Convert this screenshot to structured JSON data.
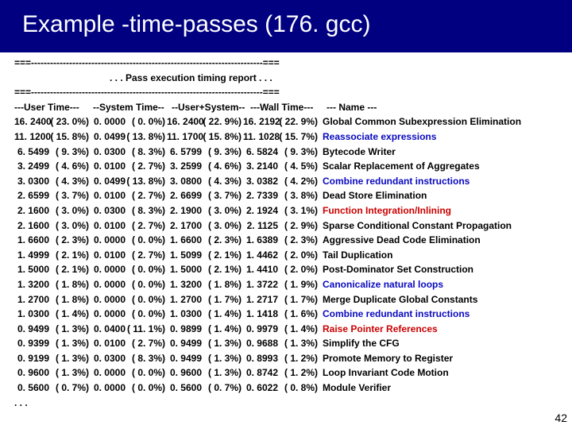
{
  "title": "Example -time-passes (176. gcc)",
  "rule": "===-------------------------------------------------------------------------===",
  "report_title": ". . . Pass execution timing report . . .",
  "headers": {
    "user": "---User Time---",
    "system": "--System Time--",
    "both": "--User+System--",
    "wall": "---Wall Time---",
    "name": "--- Name ---"
  },
  "rows": [
    {
      "u": "16. 2400",
      "up": "23. 0%",
      "s": "0. 0000",
      "sp": "0. 0%",
      "b": "16. 2400",
      "bp": "22. 9%",
      "w": "16. 2192",
      "wp": "22. 9%",
      "n": "Global Common Subexpression Elimination",
      "c": ""
    },
    {
      "u": "11. 1200",
      "up": "15. 8%",
      "s": "0. 0499",
      "sp": "13. 8%",
      "b": "11. 1700",
      "bp": "15. 8%",
      "w": "11. 1028",
      "wp": "15. 7%",
      "n": "Reassociate expressions",
      "c": "blue"
    },
    {
      "u": "6. 5499",
      "up": "9. 3%",
      "s": "0. 0300",
      "sp": "8. 3%",
      "b": "6. 5799",
      "bp": "9. 3%",
      "w": "6. 5824",
      "wp": "9. 3%",
      "n": "Bytecode Writer",
      "c": ""
    },
    {
      "u": "3. 2499",
      "up": "4. 6%",
      "s": "0. 0100",
      "sp": "2. 7%",
      "b": "3. 2599",
      "bp": "4. 6%",
      "w": "3. 2140",
      "wp": "4. 5%",
      "n": "Scalar Replacement of Aggregates",
      "c": ""
    },
    {
      "u": "3. 0300",
      "up": "4. 3%",
      "s": "0. 0499",
      "sp": "13. 8%",
      "b": "3. 0800",
      "bp": "4. 3%",
      "w": "3. 0382",
      "wp": "4. 2%",
      "n": "Combine redundant instructions",
      "c": "blue"
    },
    {
      "u": "2. 6599",
      "up": "3. 7%",
      "s": "0. 0100",
      "sp": "2. 7%",
      "b": "2. 6699",
      "bp": "3. 7%",
      "w": "2. 7339",
      "wp": "3. 8%",
      "n": "Dead Store Elimination",
      "c": ""
    },
    {
      "u": "2. 1600",
      "up": "3. 0%",
      "s": "0. 0300",
      "sp": "8. 3%",
      "b": "2. 1900",
      "bp": "3. 0%",
      "w": "2. 1924",
      "wp": "3. 1%",
      "n": "Function Integration/Inlining",
      "c": "red"
    },
    {
      "u": "2. 1600",
      "up": "3. 0%",
      "s": "0. 0100",
      "sp": "2. 7%",
      "b": "2. 1700",
      "bp": "3. 0%",
      "w": "2. 1125",
      "wp": "2. 9%",
      "n": "Sparse Conditional Constant Propagation",
      "c": ""
    },
    {
      "u": "1. 6600",
      "up": "2. 3%",
      "s": "0. 0000",
      "sp": "0. 0%",
      "b": "1. 6600",
      "bp": "2. 3%",
      "w": "1. 6389",
      "wp": "2. 3%",
      "n": "Aggressive Dead Code Elimination",
      "c": ""
    },
    {
      "u": "1. 4999",
      "up": "2. 1%",
      "s": "0. 0100",
      "sp": "2. 7%",
      "b": "1. 5099",
      "bp": "2. 1%",
      "w": "1. 4462",
      "wp": "2. 0%",
      "n": "Tail Duplication",
      "c": ""
    },
    {
      "u": "1. 5000",
      "up": "2. 1%",
      "s": "0. 0000",
      "sp": "0. 0%",
      "b": "1. 5000",
      "bp": "2. 1%",
      "w": "1. 4410",
      "wp": "2. 0%",
      "n": "Post-Dominator Set Construction",
      "c": ""
    },
    {
      "u": "1. 3200",
      "up": "1. 8%",
      "s": "0. 0000",
      "sp": "0. 0%",
      "b": "1. 3200",
      "bp": "1. 8%",
      "w": "1. 3722",
      "wp": "1. 9%",
      "n": "Canonicalize natural loops",
      "c": "blue"
    },
    {
      "u": "1. 2700",
      "up": "1. 8%",
      "s": "0. 0000",
      "sp": "0. 0%",
      "b": "1. 2700",
      "bp": "1. 7%",
      "w": "1. 2717",
      "wp": "1. 7%",
      "n": "Merge Duplicate Global Constants",
      "c": ""
    },
    {
      "u": "1. 0300",
      "up": "1. 4%",
      "s": "0. 0000",
      "sp": "0. 0%",
      "b": "1. 0300",
      "bp": "1. 4%",
      "w": "1. 1418",
      "wp": "1. 6%",
      "n": "Combine redundant instructions",
      "c": "blue"
    },
    {
      "u": "0. 9499",
      "up": "1. 3%",
      "s": "0. 0400",
      "sp": "11. 1%",
      "b": "0. 9899",
      "bp": "1. 4%",
      "w": "0. 9979",
      "wp": "1. 4%",
      "n": "Raise Pointer References",
      "c": "red"
    },
    {
      "u": "0. 9399",
      "up": "1. 3%",
      "s": "0. 0100",
      "sp": "2. 7%",
      "b": "0. 9499",
      "bp": "1. 3%",
      "w": "0. 9688",
      "wp": "1. 3%",
      "n": "Simplify the CFG",
      "c": ""
    },
    {
      "u": "0. 9199",
      "up": "1. 3%",
      "s": "0. 0300",
      "sp": "8. 3%",
      "b": "0. 9499",
      "bp": "1. 3%",
      "w": "0. 8993",
      "wp": "1. 2%",
      "n": "Promote Memory to Register",
      "c": ""
    },
    {
      "u": "0. 9600",
      "up": "1. 3%",
      "s": "0. 0000",
      "sp": "0. 0%",
      "b": "0. 9600",
      "bp": "1. 3%",
      "w": "0. 8742",
      "wp": "1. 2%",
      "n": "Loop Invariant Code Motion",
      "c": ""
    },
    {
      "u": "0. 5600",
      "up": "0. 7%",
      "s": "0. 0000",
      "sp": "0. 0%",
      "b": "0. 5600",
      "bp": "0. 7%",
      "w": "0. 6022",
      "wp": "0. 8%",
      "n": "Module Verifier",
      "c": ""
    }
  ],
  "ellipsis": ". . .",
  "page": "42"
}
